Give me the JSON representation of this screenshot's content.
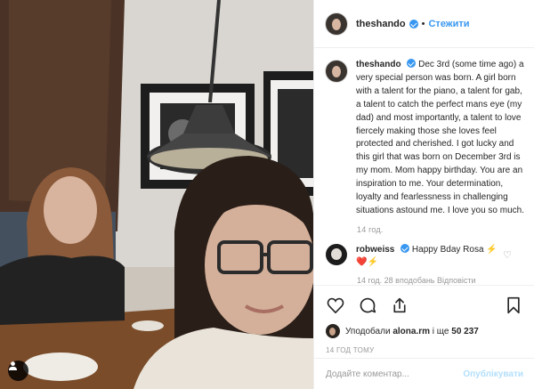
{
  "post": {
    "header": {
      "username": "theshando",
      "separator": "•",
      "follow_label": "Стежити"
    },
    "caption": {
      "username": "theshando",
      "text": "Dec 3rd (some time ago) a very special person was born. A girl born with a talent for the piano, a talent for gab, a talent to catch the perfect mans eye (my dad) and most importantly, a talent to love fiercely making those she loves feel protected and cherished. I got lucky and this girl that was born on December 3rd is my mom. Mom happy birthday. You are an inspiration to me. Your determination, loyalty and fearlessness in challenging situations astound me. I love you so much.",
      "time": "14 год."
    },
    "comments": [
      {
        "username": "robweiss",
        "text": "Happy Bday Rosa ⚡",
        "emoji_line": "❤️⚡"
      }
    ],
    "cut_off_text": "14 год.   28 вподобань   Відповісти",
    "likes": {
      "prefix": "Уподобали",
      "user": "alona.rm",
      "suffix": "і ще",
      "count": "50 237"
    },
    "posted_time": "14 ГОД ТОМУ",
    "add_comment": {
      "placeholder": "Додайте коментар...",
      "publish_label": "Опублікувати"
    },
    "icons": {
      "like": "heart-icon",
      "comment": "comment-icon",
      "share": "share-icon",
      "save": "bookmark-icon",
      "tag": "user-tag-icon",
      "verified": "verified-badge-icon"
    },
    "colors": {
      "accent": "#3897f0",
      "text": "#262626",
      "muted": "#999999",
      "publish_disabled": "#b2dffc"
    }
  }
}
